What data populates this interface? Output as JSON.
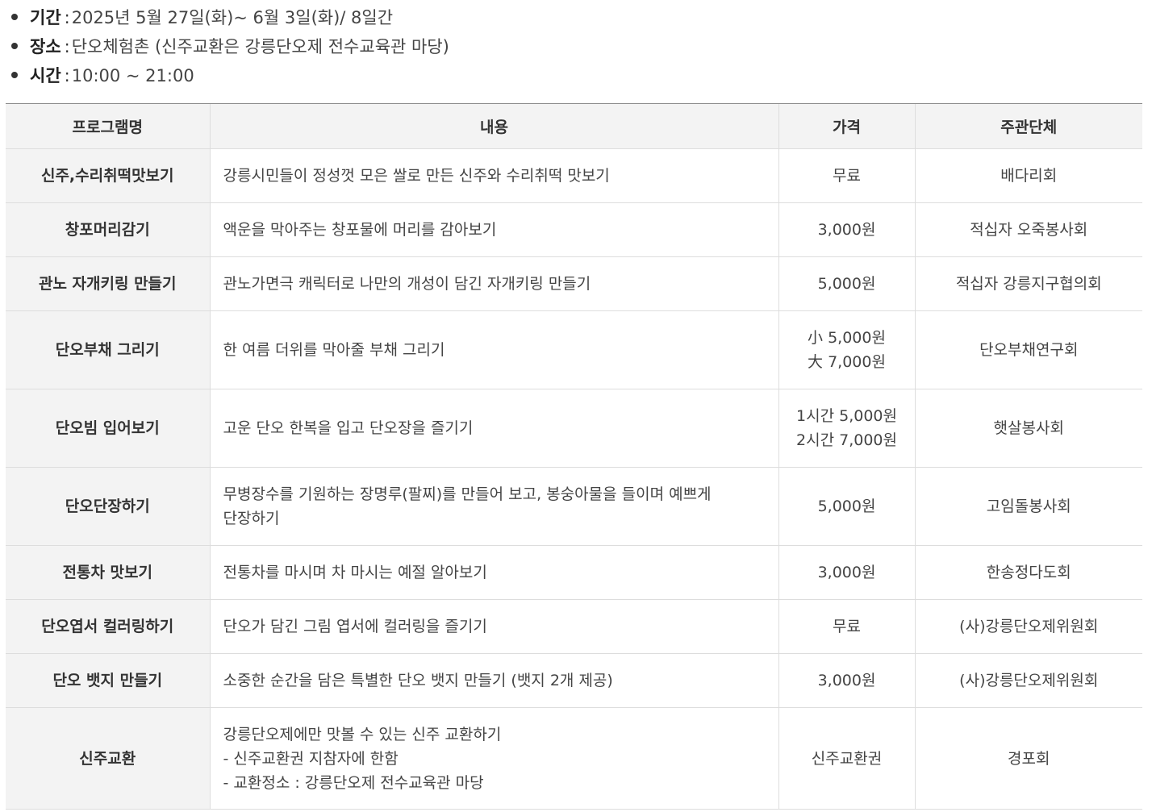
{
  "info": [
    {
      "label": "기간",
      "separator": ":",
      "value": "2025년 5월 27일(화)~ 6월 3일(화)/ 8일간"
    },
    {
      "label": "장소",
      "separator": ":",
      "value": "단오체험촌 (신주교환은 강릉단오제 전수교육관 마당)"
    },
    {
      "label": "시간",
      "separator": ":",
      "value": "10:00 ~ 21:00"
    }
  ],
  "table": {
    "headers": [
      "프로그램명",
      "내용",
      "가격",
      "주관단체"
    ],
    "rows": [
      {
        "name": "신주,수리취떡맛보기",
        "desc": [
          "강릉시민들이 정성껏 모은 쌀로 만든 신주와 수리취떡 맛보기"
        ],
        "price": [
          "무료"
        ],
        "org": "배다리회"
      },
      {
        "name": "창포머리감기",
        "desc": [
          "액운을 막아주는 창포물에 머리를 감아보기"
        ],
        "price": [
          "3,000원"
        ],
        "org": "적십자 오죽봉사회"
      },
      {
        "name": "관노 자개키링 만들기",
        "desc": [
          "관노가면극 캐릭터로 나만의 개성이 담긴 자개키링 만들기"
        ],
        "price": [
          "5,000원"
        ],
        "org": "적십자 강릉지구협의회"
      },
      {
        "name": "단오부채 그리기",
        "desc": [
          "한 여름 더위를 막아줄 부채 그리기"
        ],
        "price": [
          "小 5,000원",
          "大 7,000원"
        ],
        "org": "단오부채연구회"
      },
      {
        "name": "단오빔 입어보기",
        "desc": [
          "고운 단오 한복을 입고 단오장을 즐기기"
        ],
        "price": [
          "1시간 5,000원",
          "2시간 7,000원"
        ],
        "org": "햇살봉사회"
      },
      {
        "name": "단오단장하기",
        "desc": [
          "무병장수를 기원하는 장명루(팔찌)를 만들어 보고, 봉숭아물을 들이며 예쁘게",
          "단장하기"
        ],
        "price": [
          "5,000원"
        ],
        "org": "고임돌봉사회"
      },
      {
        "name": "전통차 맛보기",
        "desc": [
          "전통차를 마시며 차 마시는 예절 알아보기"
        ],
        "price": [
          "3,000원"
        ],
        "org": "한송정다도회"
      },
      {
        "name": "단오엽서 컬러링하기",
        "desc": [
          "단오가 담긴 그림 엽서에 컬러링을 즐기기"
        ],
        "price": [
          "무료"
        ],
        "org": "(사)강릉단오제위원회"
      },
      {
        "name": "단오 뱃지 만들기",
        "desc": [
          "소중한 순간을 담은 특별한 단오 뱃지 만들기 (뱃지 2개 제공)"
        ],
        "price": [
          "3,000원"
        ],
        "org": "(사)강릉단오제위원회"
      },
      {
        "name": "신주교환",
        "desc": [
          "강릉단오제에만 맛볼 수 있는 신주 교환하기",
          "- 신주교환권 지참자에 한함",
          "- 교환정소 : 강릉단오제 전수교육관 마당"
        ],
        "price": [
          "신주교환권"
        ],
        "org": "경포회"
      }
    ]
  }
}
